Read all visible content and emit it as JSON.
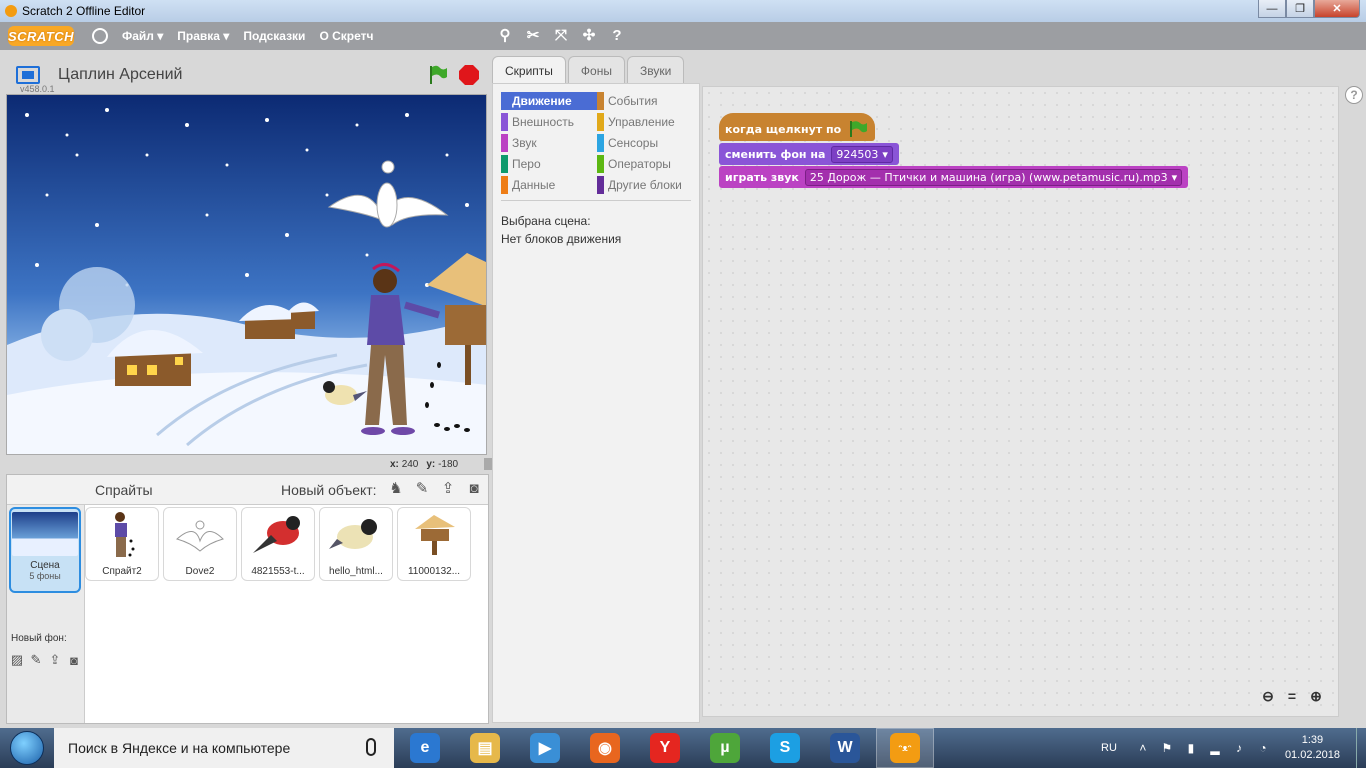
{
  "window": {
    "title": "Scratch 2 Offline Editor",
    "minimize": "—",
    "maximize": "❐",
    "close": "✕"
  },
  "menubar": {
    "logo": "SCRATCH",
    "items": [
      {
        "label": "Файл ▾"
      },
      {
        "label": "Правка ▾"
      },
      {
        "label": "Подсказки"
      },
      {
        "label": "О Скретч"
      }
    ],
    "tools": [
      "duplicate-icon",
      "delete-icon",
      "grow-icon",
      "shrink-icon",
      "help-icon"
    ]
  },
  "stage_header": {
    "version": "v458.0.1",
    "project_title": "Цаплин Арсений"
  },
  "stage": {
    "x_label": "x:",
    "x_value": "240",
    "y_label": "y:",
    "y_value": "-180"
  },
  "sprites_pane": {
    "title": "Спрайты",
    "new_object_label": "Новый объект:",
    "stage_tile": {
      "name": "Сцена",
      "count": "5 фоны"
    },
    "new_background_label": "Новый фон:",
    "sprites": [
      {
        "name": "Спрайт2",
        "icon": "girl-icon"
      },
      {
        "name": "Dove2",
        "icon": "dove-icon"
      },
      {
        "name": "4821553-t...",
        "icon": "bullfinch-icon"
      },
      {
        "name": "hello_html...",
        "icon": "titmouse-icon"
      },
      {
        "name": "11000132...",
        "icon": "birdfeeder-icon"
      }
    ]
  },
  "tabs": [
    {
      "label": "Скрипты",
      "active": true
    },
    {
      "label": "Фоны",
      "active": false
    },
    {
      "label": "Звуки",
      "active": false
    }
  ],
  "palette": {
    "categories": [
      {
        "label": "Движение",
        "color": "#4a6cd4",
        "active": true
      },
      {
        "label": "События",
        "color": "#c88330",
        "active": false
      },
      {
        "label": "Внешность",
        "color": "#8a55d7",
        "active": false
      },
      {
        "label": "Управление",
        "color": "#e1a91a",
        "active": false
      },
      {
        "label": "Звук",
        "color": "#bb42c3",
        "active": false
      },
      {
        "label": "Сенсоры",
        "color": "#2ca5e2",
        "active": false
      },
      {
        "label": "Перо",
        "color": "#0e9a6c",
        "active": false
      },
      {
        "label": "Операторы",
        "color": "#5cb712",
        "active": false
      },
      {
        "label": "Данные",
        "color": "#ee7d16",
        "active": false
      },
      {
        "label": "Другие блоки",
        "color": "#632d99",
        "active": false
      }
    ],
    "message_line1": "Выбрана сцена:",
    "message_line2": "Нет блоков движения"
  },
  "scripts": {
    "hat_label": "когда щелкнут по",
    "switch_label": "сменить фон на",
    "switch_value": "924503",
    "sound_label": "играть звук",
    "sound_value": "25 Дорож — Птички и машина (игра) (www.petamusic.ru).mp3",
    "help": "?"
  },
  "taskbar": {
    "search_placeholder": "Поиск в Яндексе и на компьютере",
    "apps": [
      {
        "icon": "ie-icon",
        "color": "#2b78d1",
        "glyph": "e"
      },
      {
        "icon": "explorer-icon",
        "color": "#e6b84a",
        "glyph": "▤"
      },
      {
        "icon": "media-icon",
        "color": "#3a8fd6",
        "glyph": "▶"
      },
      {
        "icon": "firefox-icon",
        "color": "#e8661f",
        "glyph": "◉"
      },
      {
        "icon": "yandex-icon",
        "color": "#e52620",
        "glyph": "Y"
      },
      {
        "icon": "utorrent-icon",
        "color": "#4ea63a",
        "glyph": "µ"
      },
      {
        "icon": "skype-icon",
        "color": "#1c9fe3",
        "glyph": "S"
      },
      {
        "icon": "word-icon",
        "color": "#2a5699",
        "glyph": "W"
      },
      {
        "icon": "scratch-icon",
        "color": "#f39c12",
        "glyph": "ᵔᴥᵔ"
      }
    ],
    "lang": "RU",
    "time": "1:39",
    "date": "01.02.2018"
  }
}
